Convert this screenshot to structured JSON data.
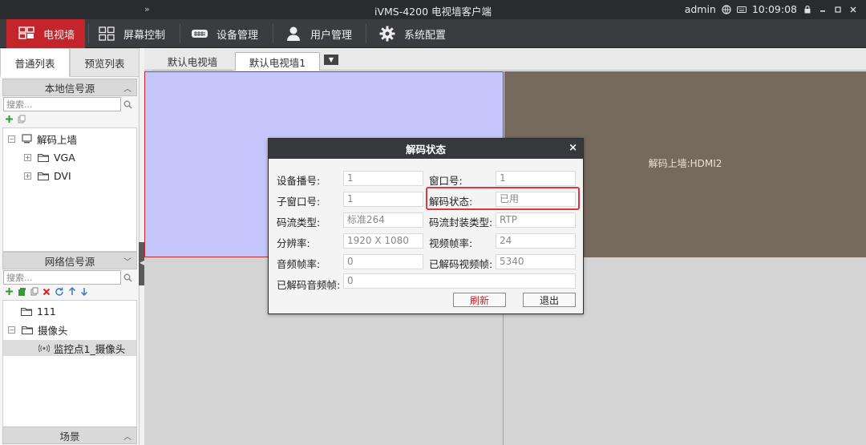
{
  "titlebar": {
    "expand": "»",
    "title": "iVMS-4200 电视墙客户端",
    "user": "admin",
    "time": "10:09:08"
  },
  "menu": {
    "items": [
      {
        "label": "电视墙",
        "icon": "video-wall-icon",
        "active": true
      },
      {
        "label": "屏幕控制",
        "icon": "screen-grid-icon",
        "active": false
      },
      {
        "label": "设备管理",
        "icon": "device-icon",
        "active": false
      },
      {
        "label": "用户管理",
        "icon": "user-icon",
        "active": false
      },
      {
        "label": "系统配置",
        "icon": "gear-icon",
        "active": false
      }
    ]
  },
  "left": {
    "tabs": [
      "普通列表",
      "预览列表"
    ],
    "local": {
      "header": "本地信号源",
      "search_placeholder": "搜索...",
      "tree": [
        {
          "label": "解码上墙",
          "level": 0,
          "icon": "monitor-icon"
        },
        {
          "label": "VGA",
          "level": 1,
          "icon": "folder-icon"
        },
        {
          "label": "DVI",
          "level": 1,
          "icon": "folder-icon"
        }
      ]
    },
    "network": {
      "header": "网络信号源",
      "search_placeholder": "搜索...",
      "tree": [
        {
          "label": "111",
          "level": 0,
          "icon": "folder-icon"
        },
        {
          "label": "摄像头",
          "level": 0,
          "icon": "folder-icon"
        },
        {
          "label": "监控点1_摄像头",
          "level": 1,
          "icon": "camera-signal-icon"
        }
      ]
    },
    "scene": {
      "header": "场景"
    }
  },
  "wall": {
    "tabs": [
      "默认电视墙",
      "默认电视墙1"
    ],
    "active_tab": 1,
    "cells": [
      {
        "label": ""
      },
      {
        "label": "解码上墙:HDMI2"
      },
      {
        "label": ""
      },
      {
        "label": ""
      }
    ]
  },
  "dialog": {
    "title": "解码状态",
    "fields": {
      "device_no": {
        "label": "设备播号:",
        "value": "1"
      },
      "window_no": {
        "label": "窗口号:",
        "value": "1"
      },
      "subwindow_no": {
        "label": "子窗口号:",
        "value": "1"
      },
      "decode_state": {
        "label": "解码状态:",
        "value": "已用"
      },
      "stream_type": {
        "label": "码流类型:",
        "value": "标准264"
      },
      "encap_type": {
        "label": "码流封装类型:",
        "value": "RTP"
      },
      "resolution": {
        "label": "分辨率:",
        "value": "1920 X 1080"
      },
      "video_fps": {
        "label": "视频帧率:",
        "value": "24"
      },
      "audio_fps": {
        "label": "音频帧率:",
        "value": "0"
      },
      "decoded_video_frames": {
        "label": "已解码视频帧:",
        "value": "5340"
      },
      "decoded_audio_frames": {
        "label": "已解码音频帧:",
        "value": "0"
      }
    },
    "refresh": "刷新",
    "exit": "退出"
  },
  "colors": {
    "accent": "#c3252b",
    "menubar": "#3b3c40",
    "highlight_box": "#d93a3a"
  }
}
